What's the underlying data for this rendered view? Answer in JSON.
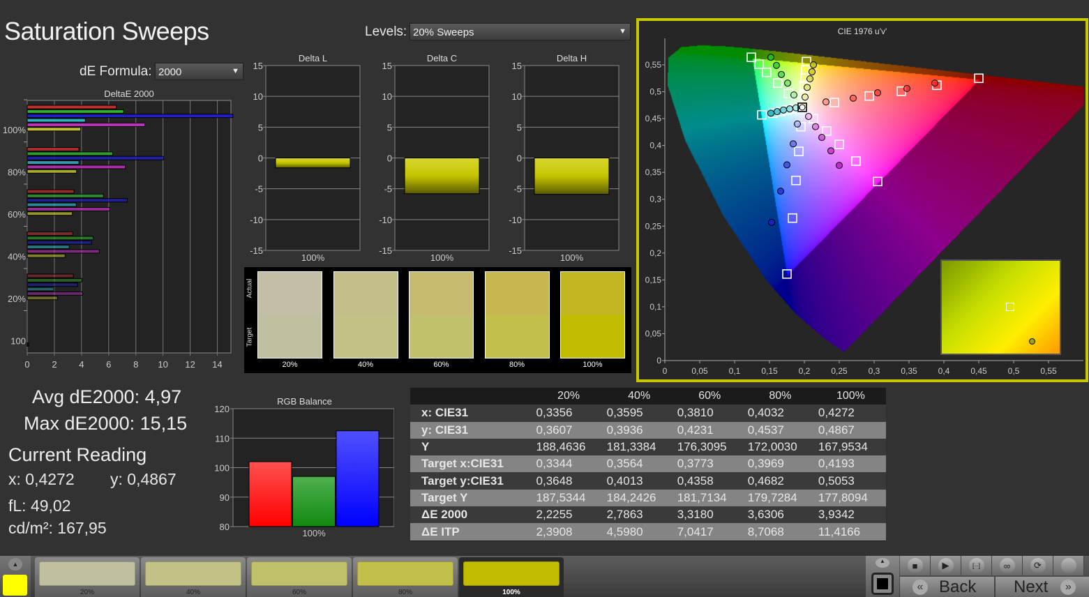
{
  "header": {
    "title": "Saturation Sweeps",
    "levels_label": "Levels:",
    "levels_value": "20% Sweeps",
    "de_formula_label": "dE Formula:",
    "de_formula_value": "2000"
  },
  "delta_e_chart": {
    "title": "DeltaE 2000",
    "type": "bar",
    "orientation": "horizontal",
    "xlim": [
      0,
      15
    ],
    "x_ticks": [
      "0",
      "2",
      "4",
      "6",
      "8",
      "10",
      "12",
      "14"
    ],
    "categories": [
      "100%",
      "80%",
      "60%",
      "40%",
      "20%",
      "100"
    ],
    "series_colors": {
      "red": "#c03030",
      "green": "#30b030",
      "blue": "#2020c0",
      "cyan": "#30b0c0",
      "magenta": "#c030c0",
      "yellow": "#c0c030"
    },
    "groups": [
      {
        "label": "100%",
        "values": {
          "red": 6.56,
          "green": 7.1,
          "blue": 15.15,
          "cyan": 4.28,
          "magenta": 8.66,
          "yellow": 3.93
        }
      },
      {
        "label": "80%",
        "values": {
          "red": 3.81,
          "green": 6.29,
          "blue": 10.05,
          "cyan": 3.81,
          "magenta": 7.22,
          "yellow": 3.63
        }
      },
      {
        "label": "60%",
        "values": {
          "red": 3.45,
          "green": 5.62,
          "blue": 7.37,
          "cyan": 3.61,
          "magenta": 6.08,
          "yellow": 3.32
        }
      },
      {
        "label": "40%",
        "values": {
          "red": 3.35,
          "green": 4.85,
          "blue": 4.74,
          "cyan": 3.09,
          "magenta": 5.31,
          "yellow": 2.79
        }
      },
      {
        "label": "20%",
        "values": {
          "red": 3.4,
          "green": 4.02,
          "blue": 3.71,
          "cyan": 1.96,
          "magenta": 4.07,
          "yellow": 2.23
        }
      },
      {
        "label": "100",
        "values": {
          "white": 0.1
        }
      }
    ]
  },
  "delta_charts": [
    {
      "title": "Delta L",
      "category": "100%",
      "value": -1.6,
      "ylim": [
        -15,
        15
      ]
    },
    {
      "title": "Delta C",
      "category": "100%",
      "value": -5.8,
      "ylim": [
        -15,
        15
      ]
    },
    {
      "title": "Delta H",
      "category": "100%",
      "value": -5.9,
      "ylim": [
        -15,
        15
      ]
    }
  ],
  "delta_y_ticks": [
    "15",
    "10",
    "5",
    "0",
    "-5",
    "-10",
    "-15"
  ],
  "swatches": {
    "actual_label": "Actual",
    "target_label": "Target",
    "items": [
      {
        "label": "20%",
        "actual": "#c2bfa6",
        "target": "#c0bfa0"
      },
      {
        "label": "40%",
        "actual": "#c4be88",
        "target": "#c2c186"
      },
      {
        "label": "60%",
        "actual": "#c6bb6e",
        "target": "#c1c06c"
      },
      {
        "label": "80%",
        "actual": "#c6b750",
        "target": "#c2c04b"
      },
      {
        "label": "100%",
        "actual": "#c4b522",
        "target": "#c2bd00"
      }
    ]
  },
  "cie_chart": {
    "title": "CIE 1976 u'v'",
    "type": "scatter",
    "xlim": [
      0,
      0.6
    ],
    "ylim": [
      0,
      0.58
    ],
    "x_ticks": [
      "0",
      "0,05",
      "0,1",
      "0,15",
      "0,2",
      "0,25",
      "0,3",
      "0,35",
      "0,4",
      "0,45",
      "0,5",
      "0,55"
    ],
    "y_ticks": [
      "0",
      "0,05",
      "0,1",
      "0,15",
      "0,2",
      "0,25",
      "0,3",
      "0,35",
      "0,4",
      "0,45",
      "0,5",
      "0,55"
    ],
    "gamut": {
      "red": [
        0.451,
        0.523
      ],
      "green": [
        0.125,
        0.563
      ],
      "blue": [
        0.175,
        0.158
      ]
    },
    "white_point": [
      0.197,
      0.471
    ],
    "border_color": "#c8c800",
    "sweeps": [
      {
        "color": "red",
        "hex": "#ff2020",
        "targets": [
          [
            0.243,
            0.48
          ],
          [
            0.293,
            0.492
          ],
          [
            0.339,
            0.501
          ],
          [
            0.39,
            0.512
          ],
          [
            0.45,
            0.525
          ]
        ],
        "measured": [
          [
            0.231,
            0.481
          ],
          [
            0.27,
            0.488
          ],
          [
            0.305,
            0.498
          ],
          [
            0.347,
            0.506
          ],
          [
            0.387,
            0.516
          ]
        ]
      },
      {
        "color": "green",
        "hex": "#20c020",
        "targets": [
          [
            0.177,
            0.497
          ],
          [
            0.162,
            0.516
          ],
          [
            0.146,
            0.536
          ],
          [
            0.135,
            0.551
          ],
          [
            0.124,
            0.564
          ]
        ],
        "measured": [
          [
            0.185,
            0.494
          ],
          [
            0.176,
            0.516
          ],
          [
            0.167,
            0.532
          ],
          [
            0.16,
            0.549
          ],
          [
            0.152,
            0.564
          ]
        ]
      },
      {
        "color": "blue",
        "hex": "#2020d0",
        "targets": [
          [
            0.195,
            0.435
          ],
          [
            0.192,
            0.389
          ],
          [
            0.188,
            0.335
          ],
          [
            0.183,
            0.265
          ],
          [
            0.175,
            0.161
          ]
        ],
        "measured": [
          [
            0.19,
            0.44
          ],
          [
            0.184,
            0.403
          ],
          [
            0.175,
            0.364
          ],
          [
            0.166,
            0.315
          ],
          [
            0.153,
            0.257
          ]
        ]
      },
      {
        "color": "cyan",
        "hex": "#20b0c0",
        "targets": [
          [
            0.186,
            0.468
          ],
          [
            0.175,
            0.466
          ],
          [
            0.166,
            0.463
          ],
          [
            0.155,
            0.46
          ],
          [
            0.139,
            0.457
          ]
        ],
        "measured": [
          [
            0.188,
            0.47
          ],
          [
            0.179,
            0.468
          ],
          [
            0.17,
            0.466
          ],
          [
            0.161,
            0.463
          ],
          [
            0.152,
            0.46
          ]
        ]
      },
      {
        "color": "magenta",
        "hex": "#c020c0",
        "targets": [
          [
            0.213,
            0.45
          ],
          [
            0.232,
            0.427
          ],
          [
            0.25,
            0.402
          ],
          [
            0.274,
            0.371
          ],
          [
            0.305,
            0.333
          ]
        ],
        "measured": [
          [
            0.206,
            0.454
          ],
          [
            0.216,
            0.435
          ],
          [
            0.225,
            0.415
          ],
          [
            0.238,
            0.39
          ],
          [
            0.25,
            0.363
          ]
        ]
      },
      {
        "color": "yellow",
        "hex": "#c0c020",
        "targets": [
          [
            0.199,
            0.493
          ],
          [
            0.2,
            0.511
          ],
          [
            0.201,
            0.525
          ],
          [
            0.202,
            0.541
          ],
          [
            0.203,
            0.556
          ]
        ],
        "measured": [
          [
            0.201,
            0.49
          ],
          [
            0.204,
            0.508
          ],
          [
            0.208,
            0.524
          ],
          [
            0.211,
            0.537
          ],
          [
            0.213,
            0.55
          ]
        ]
      }
    ]
  },
  "stats": {
    "avg": "Avg dE2000: 4,97",
    "max": "Max dE2000: 15,15",
    "current_reading": "Current Reading",
    "x": "x: 0,4272",
    "y": "y: 0,4867",
    "fl": "fL: 49,02",
    "cdm2": "cd/m²: 167,95"
  },
  "rgb_balance": {
    "title": "RGB Balance",
    "type": "bar",
    "category": "100%",
    "ylim": [
      80,
      120
    ],
    "y_ticks": [
      "120",
      "110",
      "100",
      "90",
      "80"
    ],
    "values": {
      "red": 102,
      "green": 97,
      "blue": 112.5
    }
  },
  "table": {
    "columns": [
      "",
      "20%",
      "40%",
      "60%",
      "80%",
      "100%"
    ],
    "rows": [
      [
        "x: CIE31",
        "0,3356",
        "0,3595",
        "0,3810",
        "0,4032",
        "0,4272"
      ],
      [
        "y: CIE31",
        "0,3607",
        "0,3936",
        "0,4231",
        "0,4537",
        "0,4867"
      ],
      [
        "Y",
        "188,4636",
        "181,3384",
        "176,3095",
        "172,0030",
        "167,9534"
      ],
      [
        "Target x:CIE31",
        "0,3344",
        "0,3564",
        "0,3773",
        "0,3969",
        "0,4193"
      ],
      [
        "Target y:CIE31",
        "0,3648",
        "0,4013",
        "0,4358",
        "0,4682",
        "0,5053"
      ],
      [
        "Target Y",
        "187,5344",
        "184,2426",
        "181,7134",
        "179,7284",
        "177,8094"
      ],
      [
        "ΔE 2000",
        "2,2255",
        "2,7863",
        "3,3180",
        "3,6306",
        "3,9342"
      ],
      [
        "ΔE ITP",
        "2,3908",
        "4,5980",
        "7,0417",
        "8,7068",
        "11,4166"
      ]
    ]
  },
  "bottom": {
    "current_color": "#ffff00",
    "tiles": [
      {
        "label": "20%",
        "color": "#c0bfa0"
      },
      {
        "label": "40%",
        "color": "#c2c186"
      },
      {
        "label": "60%",
        "color": "#c1c06c"
      },
      {
        "label": "80%",
        "color": "#c2c04b"
      },
      {
        "label": "100%",
        "color": "#c2bd00"
      }
    ],
    "back_label": "Back",
    "next_label": "Next",
    "controls": [
      "stop-icon",
      "play-icon",
      "loop-range-icon",
      "infinity-icon",
      "refresh-icon",
      "record-icon"
    ]
  }
}
